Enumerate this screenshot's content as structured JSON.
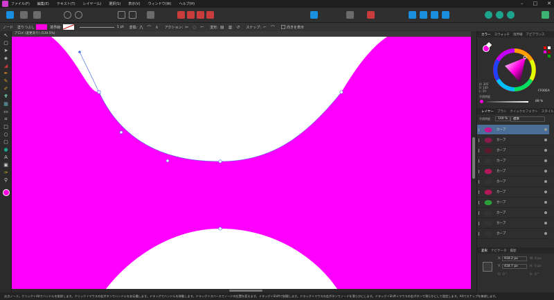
{
  "menu": {
    "items": [
      "ファイル(F)",
      "編集(E)",
      "テキスト(T)",
      "レイヤー(L)",
      "選択(S)",
      "表示(V)",
      "ウィンドウ(W)",
      "ヘルプ(H)"
    ]
  },
  "context": {
    "node_label": "ノード",
    "fill_label": "塗りつぶし",
    "stroke_label": "境界線:",
    "width_value": "1 pt",
    "transform_label": "変換:",
    "action_label": "アクション:",
    "convert_label": "変形:",
    "snap_label": "スナップ:",
    "show_label": "向きを表示"
  },
  "document": {
    "tab_title": "アロメ (変更あり) (539.5%)"
  },
  "color_panel": {
    "tabs": [
      "カラー",
      "スウォッチ",
      "境界線",
      "アピアランス"
    ],
    "hsl": [
      "H: 305",
      "S: 100",
      "L: 50"
    ],
    "hex": "FF00EA",
    "opacity_label": "不透明度",
    "opacity_value": "89 %",
    "accent": "#ff00e0"
  },
  "layers_panel": {
    "tabs": [
      "レイヤー",
      "ブラシ",
      "クイックエフェクト",
      "スタイル"
    ],
    "opacity_label": "不透明度",
    "opacity_value": "100 %",
    "blend_mode": "標準",
    "rows": [
      {
        "name": "カーブ",
        "selected": true,
        "thumb": "#c0198c"
      },
      {
        "name": "カーブ",
        "selected": false,
        "thumb": "#8a1a4a"
      },
      {
        "name": "カーブ",
        "selected": false,
        "thumb": "#5a1a2a"
      },
      {
        "name": "カーブ",
        "selected": false,
        "thumb": "#333333"
      },
      {
        "name": "カーブ",
        "selected": false,
        "thumb": "#b0185a"
      },
      {
        "name": "カーブ",
        "selected": false,
        "thumb": "#333333"
      },
      {
        "name": "カーブ",
        "selected": false,
        "thumb": "#b0185a"
      },
      {
        "name": "カーブ",
        "selected": false,
        "thumb": "#2aa03a"
      },
      {
        "name": "カーブ",
        "selected": false,
        "thumb": "#333333"
      },
      {
        "name": "カーブ",
        "selected": false,
        "thumb": "#333333"
      },
      {
        "name": "カーブ",
        "selected": false,
        "thumb": "#333333"
      }
    ]
  },
  "transform_panel": {
    "tabs": [
      "変形",
      "ナビゲータ",
      "履歴"
    ],
    "x_label": "X:",
    "x_value": "918.2 px",
    "y_label": "Y:",
    "y_value": "418.7 px",
    "w_label": "W:",
    "w_value": "0 px",
    "h_label": "H:",
    "h_value": "0 px",
    "r_label": "R:",
    "r_value": "0 °",
    "s_label": "S:",
    "s_value": "0 °"
  },
  "status": {
    "text": "尖点ノード。クリック＋Altでハンドルを削除します。クリック＋マウスの右ボタンでハンドルを非伝播します。ドラッグでハンドルを移動します。ドラッグ＋スペースでノードの位置を変えます。ドラッグ＋Shiftで制限します。ドラッグ＋マウスの右ボタンでノードを滑らかにします。ドラッグ＋Shift＋マウスの右ボタンで滑らかにして固定します。Altでスナップを無視します。"
  },
  "colors": {
    "canvas_fill": "#ff00ff",
    "selection": "#4a6e95",
    "toolbar_blue": "#1a8fe0"
  }
}
